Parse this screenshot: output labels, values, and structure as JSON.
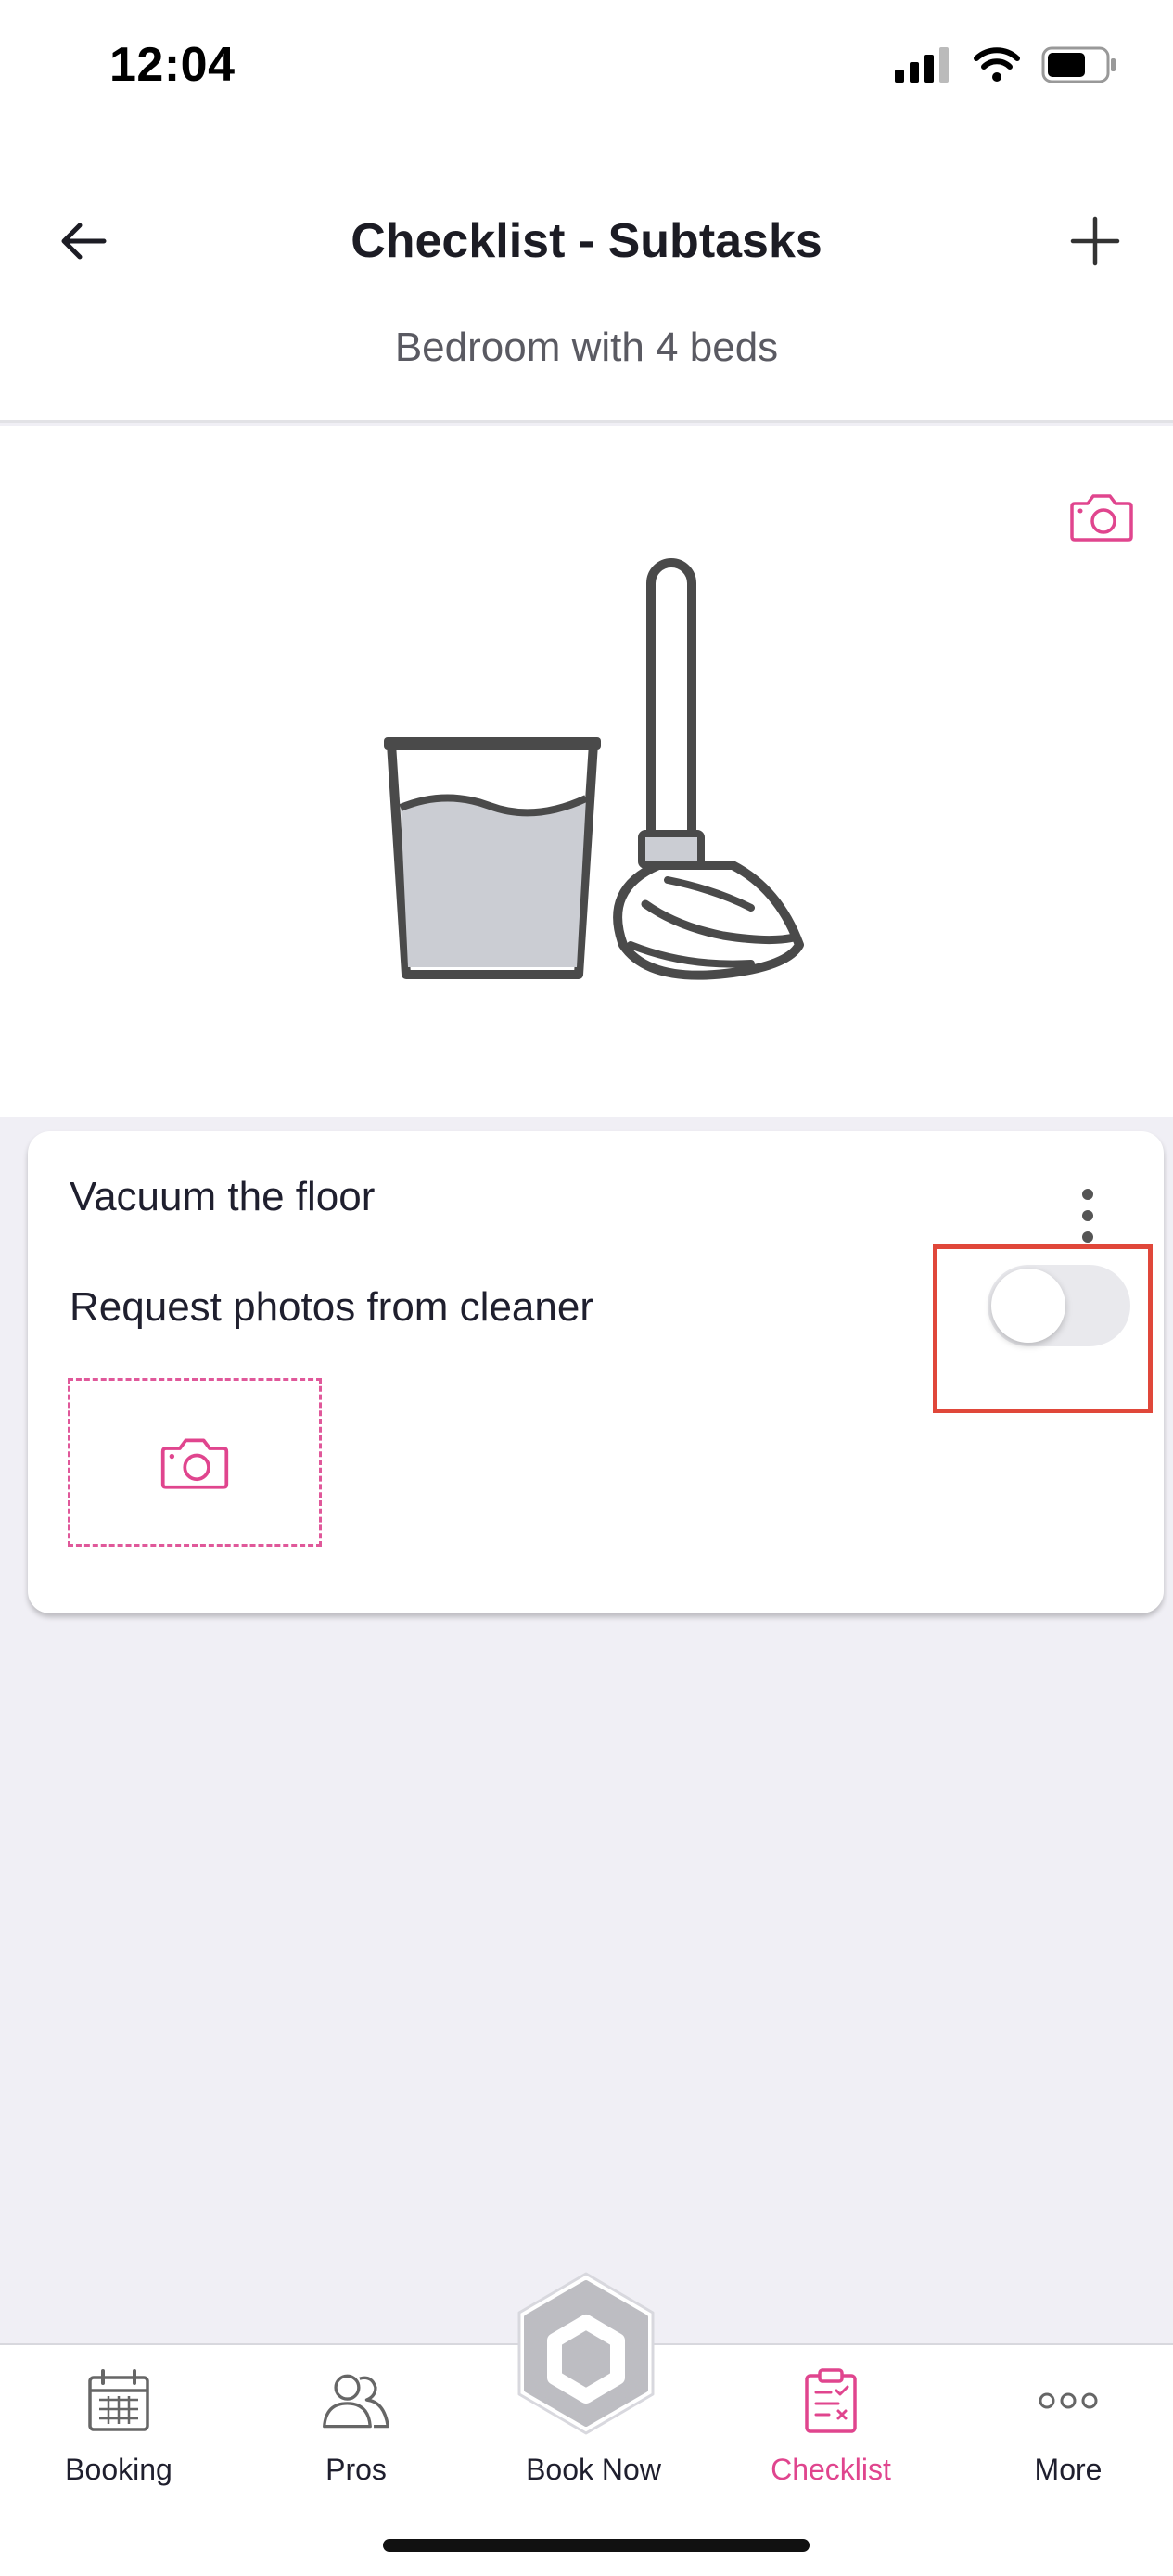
{
  "status_bar": {
    "time": "12:04"
  },
  "header": {
    "title": "Checklist - Subtasks",
    "subtitle": "Bedroom with 4 beds"
  },
  "card": {
    "task_title": "Vacuum the floor",
    "photo_request_label": "Request photos from cleaner",
    "photo_request_enabled": false
  },
  "tabbar": {
    "items": [
      {
        "label": "Booking",
        "icon": "calendar-icon"
      },
      {
        "label": "Pros",
        "icon": "people-icon"
      },
      {
        "label": "Book Now",
        "icon": "hexagon-logo-icon"
      },
      {
        "label": "Checklist",
        "icon": "clipboard-checklist-icon",
        "active": true
      },
      {
        "label": "More",
        "icon": "more-dots-icon"
      }
    ]
  },
  "colors": {
    "accent": "#e0458e",
    "highlight": "#e0473a",
    "background": "#f0eff5"
  }
}
